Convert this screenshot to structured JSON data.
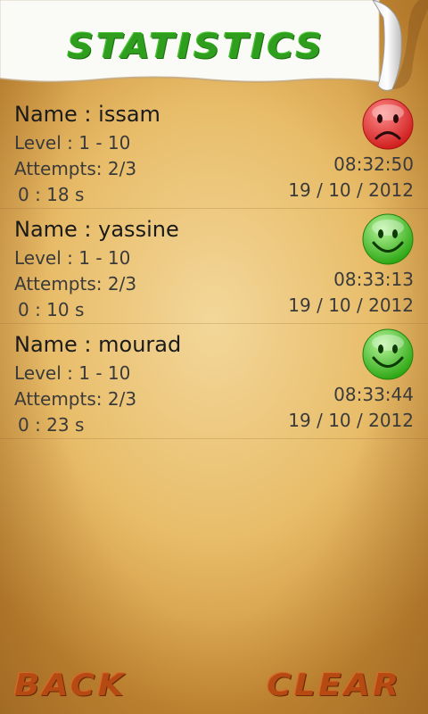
{
  "header": {
    "title": "STATISTICS"
  },
  "stats": [
    {
      "name": "Name : issam",
      "level": "Level : 1 - 10",
      "attempts": "Attempts: 2/3",
      "duration": "0 : 18 s",
      "time": "08:32:50",
      "date": "19 / 10 / 2012",
      "face": "sad-face-icon",
      "face_color": "#e53b3b"
    },
    {
      "name": "Name : yassine",
      "level": "Level : 1 - 10",
      "attempts": "Attempts: 2/3",
      "duration": "0 : 10 s",
      "time": "08:33:13",
      "date": "19 / 10 / 2012",
      "face": "smiley-face-icon",
      "face_color": "#45c42a"
    },
    {
      "name": "Name : mourad",
      "level": "Level : 1 - 10",
      "attempts": "Attempts: 2/3",
      "duration": "0 : 23 s",
      "time": "08:33:44",
      "date": "19 / 10 / 2012",
      "face": "smiley-face-icon",
      "face_color": "#45c42a"
    }
  ],
  "footer": {
    "back_label": "BACK",
    "clear_label": "CLEAR"
  }
}
